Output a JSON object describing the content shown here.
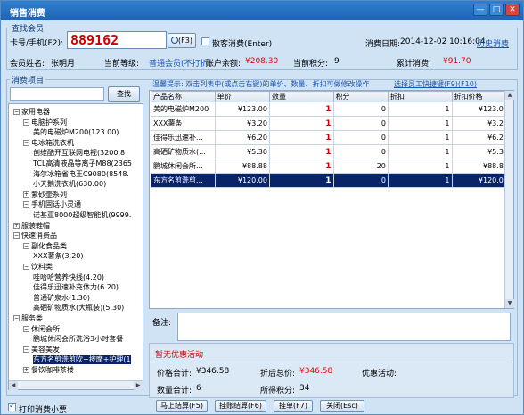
{
  "window": {
    "title": "销售消费",
    "min_label": "—",
    "max_label": "□",
    "close_label": "✕"
  },
  "member_search": {
    "group_label": "查找会员",
    "card_label": "卡号/手机(F2):",
    "card_value": "889162",
    "search_button_label": "(F3)",
    "walkin_label": "散客消费(Enter)",
    "date_label": "消费日期:",
    "date_value": "2014-12-02 10:16:04",
    "history_link": "历史消费",
    "name_label": "会员姓名:",
    "name_value": "张明月",
    "level_label": "当前等级:",
    "level_value": "普通会员(不打折)",
    "balance_label": "账户余额:",
    "balance_value": "¥208.30",
    "points_label": "当前积分:",
    "points_value": "9",
    "total_label": "累计消费:",
    "total_value": "¥91.70"
  },
  "products": {
    "group_label": "消费项目",
    "search_button_label": "查找",
    "hint_text": "温馨提示: 双击列表中(或点击右键)的单价、数量、折扣可做修改操作",
    "staff_link": "选择员工快捷键(F9)(F10)",
    "tree": [
      {
        "label": "家用电器",
        "level": 0,
        "expander": "−"
      },
      {
        "label": "电脑护系列",
        "level": 1,
        "expander": "−"
      },
      {
        "label": "美的电磁炉M200(123.00)",
        "level": 2,
        "expander": ""
      },
      {
        "label": "电冰箱洗衣机",
        "level": 1,
        "expander": "−"
      },
      {
        "label": "创维酷开互联网电视(3200.8",
        "level": 2,
        "expander": ""
      },
      {
        "label": "TCL高清液晶等离子M88(2365",
        "level": 2,
        "expander": ""
      },
      {
        "label": "海尔冰箱省电王C9080(8548.",
        "level": 2,
        "expander": ""
      },
      {
        "label": "小天鹅洗衣机(630.00)",
        "level": 2,
        "expander": ""
      },
      {
        "label": "紫砂壶系列",
        "level": 1,
        "expander": "+"
      },
      {
        "label": "手机固话小灵通",
        "level": 1,
        "expander": "−"
      },
      {
        "label": "诺基亚8000超级智能机(9999.",
        "level": 2,
        "expander": ""
      },
      {
        "label": "服装鞋帽",
        "level": 0,
        "expander": "+"
      },
      {
        "label": "快速消费品",
        "level": 0,
        "expander": "−"
      },
      {
        "label": "副化食品类",
        "level": 1,
        "expander": "−"
      },
      {
        "label": "XXX薯条(3.20)",
        "level": 2,
        "expander": ""
      },
      {
        "label": "饮料类",
        "level": 1,
        "expander": "−"
      },
      {
        "label": "哇哈哈营养快线(4.20)",
        "level": 2,
        "expander": ""
      },
      {
        "label": "佳得乐迅速补充体力(6.20)",
        "level": 2,
        "expander": ""
      },
      {
        "label": "普通矿泉水(1.30)",
        "level": 2,
        "expander": ""
      },
      {
        "label": "高硒矿物质水(大瓶装)(5.30)",
        "level": 2,
        "expander": ""
      },
      {
        "label": "服务类",
        "level": 0,
        "expander": "−"
      },
      {
        "label": "休闲会所",
        "level": 1,
        "expander": "−"
      },
      {
        "label": "鹏城休闲会所洗浴3小时套餐",
        "level": 2,
        "expander": ""
      },
      {
        "label": "美容美发",
        "level": 1,
        "expander": "−"
      },
      {
        "label": "东方名剪洗剪吹+按摩+护理(1",
        "level": 2,
        "expander": "",
        "selected": true
      },
      {
        "label": "餐饮咖啡茶楼",
        "level": 1,
        "expander": "+"
      }
    ],
    "columns": [
      "产品名称",
      "单价",
      "数量",
      "积分",
      "折扣",
      "折扣价格"
    ],
    "rows": [
      {
        "name": "美的电磁炉M200",
        "price": "¥123.00",
        "qty": "1",
        "points": "0",
        "discount": "1",
        "discount_price": "¥123.00"
      },
      {
        "name": "XXX薯条",
        "price": "¥3.20",
        "qty": "1",
        "points": "0",
        "discount": "1",
        "discount_price": "¥3.20"
      },
      {
        "name": "佳得乐迅速补...",
        "price": "¥6.20",
        "qty": "1",
        "points": "0",
        "discount": "1",
        "discount_price": "¥6.20"
      },
      {
        "name": "高硒矿物质水(...",
        "price": "¥5.30",
        "qty": "1",
        "points": "0",
        "discount": "1",
        "discount_price": "¥5.30"
      },
      {
        "name": "鹏城休闲会所...",
        "price": "¥88.88",
        "qty": "1",
        "points": "20",
        "discount": "1",
        "discount_price": "¥88.88"
      },
      {
        "name": "东方名剪洗剪...",
        "price": "¥120.00",
        "qty": "1",
        "points": "0",
        "discount": "1",
        "discount_price": "¥120.00",
        "selected": true
      }
    ]
  },
  "memo": {
    "label": "备注:",
    "value": ""
  },
  "promotion": {
    "title": "暂无优惠活动",
    "total_price_label": "价格合计:",
    "total_price_value": "¥346.58",
    "discount_total_label": "折后总价:",
    "discount_total_value": "¥346.58",
    "activity_label": "优惠活动:",
    "activity_value": "",
    "qty_total_label": "数量合计:",
    "qty_total_value": "6",
    "points_earned_label": "所得积分:",
    "points_earned_value": "34"
  },
  "footer": {
    "print_receipt_label": "打印消费小票",
    "print_receipt_checked": true,
    "pay_button": "马上结算(F5)",
    "pay_later_button": "挂账结算(F6)",
    "hold_button": "挂单(F7)",
    "close_button": "关闭(Esc)"
  }
}
